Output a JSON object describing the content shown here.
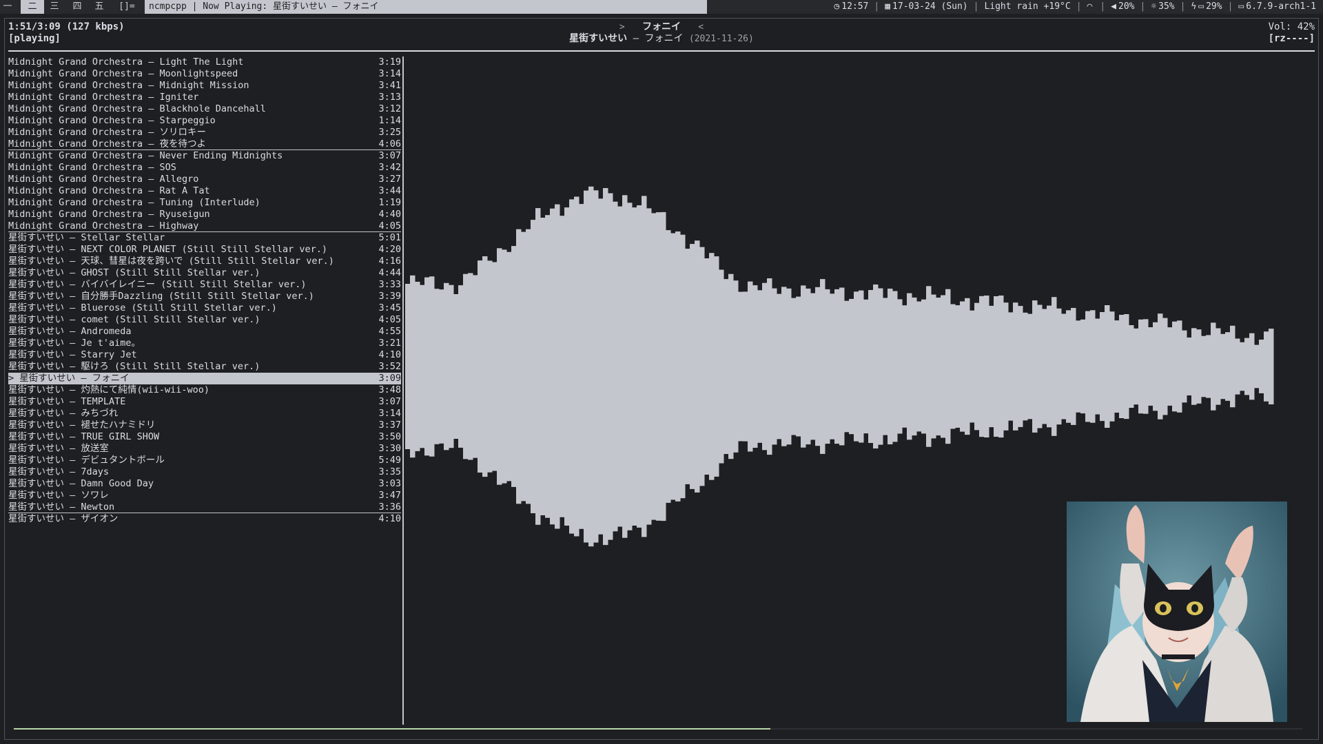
{
  "bar": {
    "workspaces": [
      {
        "label": "一",
        "active": false
      },
      {
        "label": "二",
        "active": true
      },
      {
        "label": "三",
        "active": false
      },
      {
        "label": "四",
        "active": false
      },
      {
        "label": "五",
        "active": false
      }
    ],
    "layout_symbol": "[]=",
    "window_title": "ncmpcpp | Now Playing: 星街すいせい – フォニイ",
    "clock": "12:57",
    "date": "17-03-24 (Sun)",
    "weather": "Light rain +19°C",
    "volume": "20%",
    "brightness": "35%",
    "battery": "29%",
    "kernel": "6.7.9-arch1-1"
  },
  "header": {
    "elapsed": "1:51/3:09 (127 kbps)",
    "state": "[playing]",
    "nav_left": ">",
    "song": "フォニイ",
    "nav_right": "<",
    "artist": "星街すいせい",
    "title_sep": " – ",
    "title": "フォニイ",
    "date": "(2021-11-26)",
    "volume": "Vol: 42%",
    "flags": "[rz----]"
  },
  "playlist": [
    {
      "title": "Midnight Grand Orchestra – Light The Light",
      "time": "3:19"
    },
    {
      "title": "Midnight Grand Orchestra – Moonlightspeed",
      "time": "3:14"
    },
    {
      "title": "Midnight Grand Orchestra – Midnight Mission",
      "time": "3:41"
    },
    {
      "title": "Midnight Grand Orchestra – Igniter",
      "time": "3:13"
    },
    {
      "title": "Midnight Grand Orchestra – Blackhole Dancehall",
      "time": "3:12"
    },
    {
      "title": "Midnight Grand Orchestra – Starpeggio",
      "time": "1:14"
    },
    {
      "title": "Midnight Grand Orchestra – ソリロキー",
      "time": "3:25"
    },
    {
      "title": "Midnight Grand Orchestra – 夜を待つよ",
      "time": "4:06",
      "underline": true
    },
    {
      "title": "Midnight Grand Orchestra – Never Ending Midnights",
      "time": "3:07"
    },
    {
      "title": "Midnight Grand Orchestra – SOS",
      "time": "3:42"
    },
    {
      "title": "Midnight Grand Orchestra – Allegro",
      "time": "3:27"
    },
    {
      "title": "Midnight Grand Orchestra – Rat A Tat",
      "time": "3:44"
    },
    {
      "title": "Midnight Grand Orchestra – Tuning (Interlude)",
      "time": "1:19"
    },
    {
      "title": "Midnight Grand Orchestra – Ryuseigun",
      "time": "4:40"
    },
    {
      "title": "Midnight Grand Orchestra – Highway",
      "time": "4:05",
      "underline": true
    },
    {
      "title": "星街すいせい – Stellar Stellar",
      "time": "5:01"
    },
    {
      "title": "星街すいせい – NEXT COLOR PLANET (Still Still Stellar ver.)",
      "time": "4:20"
    },
    {
      "title": "星街すいせい – 天球、彗星は夜を跨いで (Still Still Stellar ver.)",
      "time": "4:16"
    },
    {
      "title": "星街すいせい – GHOST (Still Still Stellar ver.)",
      "time": "4:44"
    },
    {
      "title": "星街すいせい – バイバイレイニー (Still Still Stellar ver.)",
      "time": "3:33"
    },
    {
      "title": "星街すいせい – 自分勝手Dazzling (Still Still Stellar ver.)",
      "time": "3:39"
    },
    {
      "title": "星街すいせい – Bluerose (Still Still Stellar ver.)",
      "time": "3:45"
    },
    {
      "title": "星街すいせい – comet (Still Still Stellar ver.)",
      "time": "4:05"
    },
    {
      "title": "星街すいせい – Andromeda",
      "time": "4:55"
    },
    {
      "title": "星街すいせい – Je t'aime。",
      "time": "3:21"
    },
    {
      "title": "星街すいせい – Starry Jet",
      "time": "4:10"
    },
    {
      "title": "星街すいせい – 駆けろ (Still Still Stellar ver.)",
      "time": "3:52"
    },
    {
      "title": "> 星街すいせい – フォニイ",
      "time": "3:09",
      "current": true
    },
    {
      "title": "星街すいせい – 灼熱にて純情(wii-wii-woo)",
      "time": "3:48"
    },
    {
      "title": "星街すいせい – TEMPLATE",
      "time": "3:07"
    },
    {
      "title": "星街すいせい – みちづれ",
      "time": "3:14"
    },
    {
      "title": "星街すいせい – 褪せたハナミドリ",
      "time": "3:37"
    },
    {
      "title": "星街すいせい – TRUE GIRL SHOW",
      "time": "3:50"
    },
    {
      "title": "星街すいせい – 放送室",
      "time": "3:30"
    },
    {
      "title": "星街すいせい – デビュタントボール",
      "time": "5:49"
    },
    {
      "title": "星街すいせい – 7days",
      "time": "3:35"
    },
    {
      "title": "星街すいせい – Damn Good Day",
      "time": "3:03"
    },
    {
      "title": "星街すいせい – ソワレ",
      "time": "3:47"
    },
    {
      "title": "星街すいせい – Newton",
      "time": "3:36",
      "underline": true
    },
    {
      "title": "星街すいせい – ザイオン",
      "time": "4:10"
    }
  ],
  "playback_progress": 0.587,
  "colors": {
    "background": "#1e1f22",
    "foreground": "#d9dde4",
    "highlight": "#c3c6cc",
    "visualizer": "#c3c6cc",
    "progress": "#b9d7a8"
  }
}
